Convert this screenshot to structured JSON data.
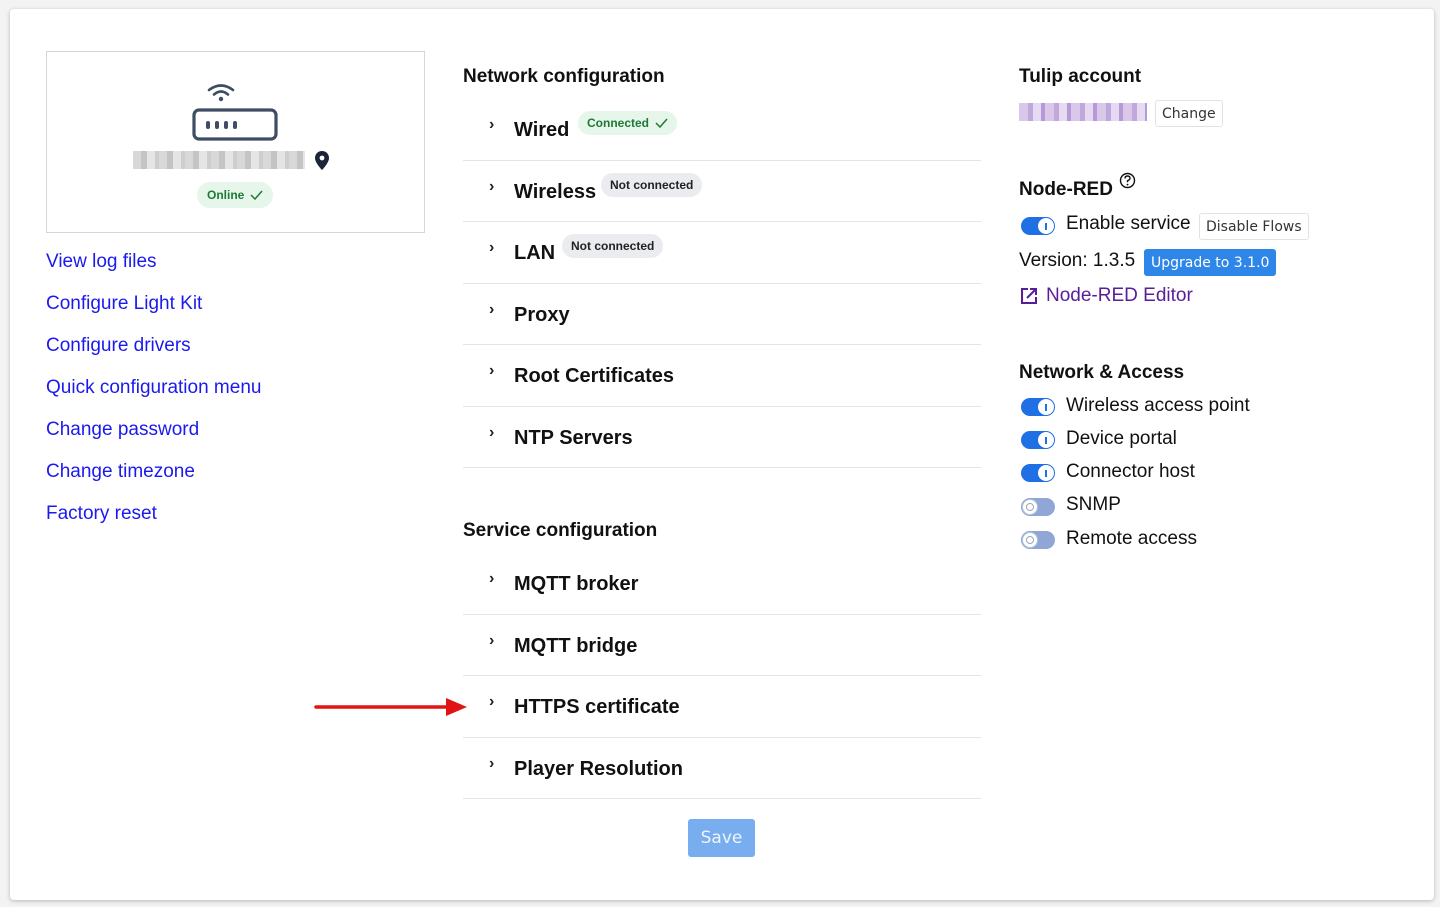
{
  "device": {
    "name": "[redacted]",
    "status": "Online"
  },
  "left_links": [
    "View log files",
    "Configure Light Kit",
    "Configure drivers",
    "Quick configuration menu",
    "Change password",
    "Change timezone",
    "Factory reset"
  ],
  "network_config": {
    "title": "Network configuration",
    "items": [
      {
        "label": "Wired",
        "badge": "Connected",
        "badge_state": "connected"
      },
      {
        "label": "Wireless",
        "badge": "Not connected",
        "badge_state": "not-connected"
      },
      {
        "label": "LAN",
        "badge": "Not connected",
        "badge_state": "not-connected"
      },
      {
        "label": "Proxy"
      },
      {
        "label": "Root Certificates"
      },
      {
        "label": "NTP Servers"
      }
    ]
  },
  "service_config": {
    "title": "Service configuration",
    "items": [
      {
        "label": "MQTT broker"
      },
      {
        "label": "MQTT bridge"
      },
      {
        "label": "HTTPS certificate",
        "highlighted_by_arrow": true
      },
      {
        "label": "Player Resolution"
      }
    ]
  },
  "save_label": "Save",
  "tulip_account": {
    "title": "Tulip account",
    "account_name": "[redacted]",
    "change_label": "Change"
  },
  "node_red": {
    "title": "Node-RED",
    "enable_label": "Enable service",
    "enabled": true,
    "disable_flows_label": "Disable Flows",
    "version_text": "Version: 1.3.5",
    "upgrade_label": "Upgrade to 3.1.0",
    "editor_link": "Node-RED Editor"
  },
  "network_access": {
    "title": "Network & Access",
    "toggles": [
      {
        "label": "Wireless access point",
        "enabled": true
      },
      {
        "label": "Device portal",
        "enabled": true
      },
      {
        "label": "Connector host",
        "enabled": true
      },
      {
        "label": "SNMP",
        "enabled": false
      },
      {
        "label": "Remote access",
        "enabled": false
      }
    ]
  },
  "colors": {
    "link": "#1a1af0",
    "toggle_on": "#1f6fe5",
    "toggle_off": "#8fa6d6",
    "upgrade": "#2f86e9",
    "save_disabled": "#78adf0",
    "editor_link": "#5a1d97",
    "success_bg": "#e6f6ea",
    "success_text": "#1e7a34",
    "annotation_arrow": "#e01414"
  }
}
